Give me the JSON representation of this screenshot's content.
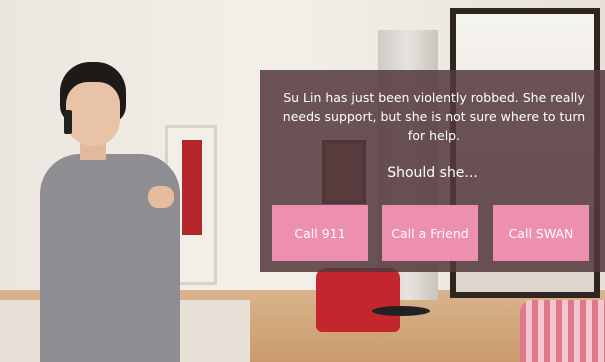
{
  "scenario": {
    "prompt": "Su Lin has just been violently robbed. She really needs support, but she is not sure where to turn for help.",
    "question": "Should she...",
    "choices": [
      {
        "label": "Call 911"
      },
      {
        "label": "Call a Friend"
      },
      {
        "label": "Call SWAN"
      }
    ]
  },
  "colors": {
    "panel": "#54383c",
    "button": "#ec8fb0",
    "text": "#ffffff"
  }
}
